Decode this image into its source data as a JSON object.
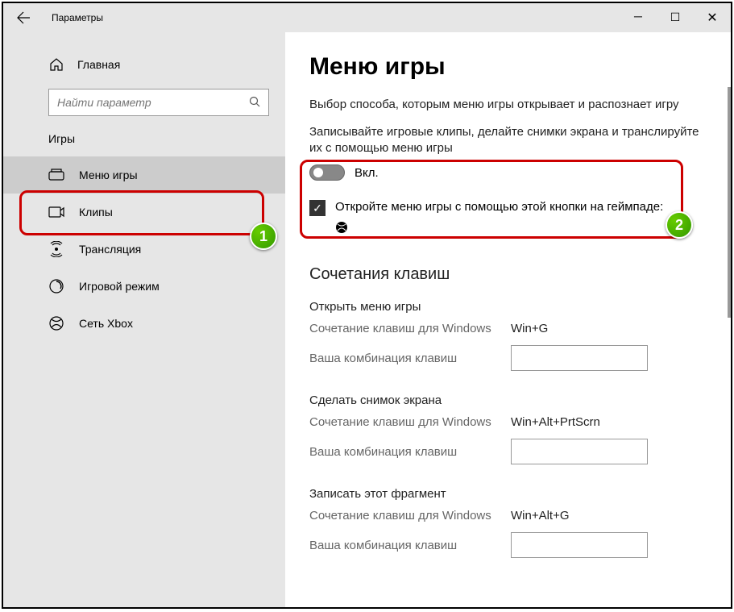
{
  "window": {
    "title": "Параметры"
  },
  "sidebar": {
    "home": "Главная",
    "searchPlaceholder": "Найти параметр",
    "category": "Игры",
    "items": [
      {
        "label": "Меню игры"
      },
      {
        "label": "Клипы"
      },
      {
        "label": "Трансляция"
      },
      {
        "label": "Игровой режим"
      },
      {
        "label": "Сеть Xbox"
      }
    ]
  },
  "content": {
    "heading": "Меню игры",
    "description": "Выбор способа, которым меню игры открывает и распознает игру",
    "recordLabel": "Записывайте игровые клипы, делайте снимки экрана и транслируйте их с помощью меню игры",
    "toggleLabel": "Вкл.",
    "checkboxLabel": "Откройте меню игры с помощью этой кнопки на геймпаде:",
    "shortcutsHeading": "Сочетания клавиш",
    "labels": {
      "windows": "Сочетание клавиш для Windows",
      "custom": "Ваша комбинация клавиш"
    },
    "shortcuts": [
      {
        "title": "Открыть меню игры",
        "value": "Win+G"
      },
      {
        "title": "Сделать снимок экрана",
        "value": "Win+Alt+PrtScrn"
      },
      {
        "title": "Записать этот фрагмент",
        "value": "Win+Alt+G"
      }
    ]
  },
  "annotations": {
    "badge1": "1",
    "badge2": "2"
  }
}
